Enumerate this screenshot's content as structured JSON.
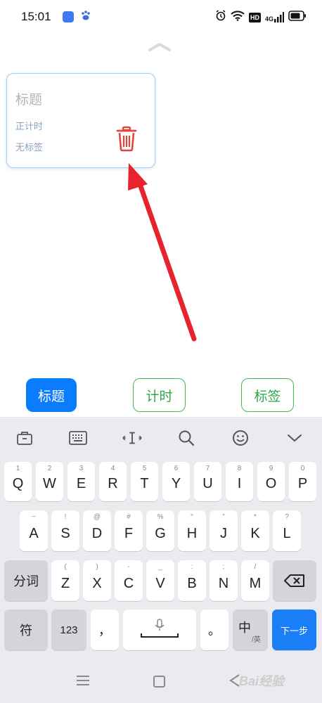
{
  "status_bar": {
    "time": "15:01",
    "hd_badge": "HD",
    "network": "4G"
  },
  "card": {
    "title_placeholder": "标题",
    "timer_label": "正计时",
    "tag_label": "无标签",
    "delete_icon": "trash-icon"
  },
  "annotation": {
    "arrow_color": "#e8232d"
  },
  "mode_buttons": [
    {
      "label": "标题",
      "selected": true
    },
    {
      "label": "计时",
      "selected": false
    },
    {
      "label": "标签",
      "selected": false
    }
  ],
  "keyboard": {
    "toolbar": [
      "toolbox-icon",
      "keyboard-icon",
      "cursor-icon",
      "search-icon",
      "emoji-icon",
      "collapse-icon"
    ],
    "row1": [
      {
        "key": "Q",
        "hint": "1"
      },
      {
        "key": "W",
        "hint": "2"
      },
      {
        "key": "E",
        "hint": "3"
      },
      {
        "key": "R",
        "hint": "4"
      },
      {
        "key": "T",
        "hint": "5"
      },
      {
        "key": "Y",
        "hint": "6"
      },
      {
        "key": "U",
        "hint": "7"
      },
      {
        "key": "I",
        "hint": "8"
      },
      {
        "key": "O",
        "hint": "9"
      },
      {
        "key": "P",
        "hint": "0"
      }
    ],
    "row2": [
      {
        "key": "A",
        "hint": "~"
      },
      {
        "key": "S",
        "hint": "!"
      },
      {
        "key": "D",
        "hint": "@"
      },
      {
        "key": "F",
        "hint": "#"
      },
      {
        "key": "G",
        "hint": "%"
      },
      {
        "key": "H",
        "hint": "“"
      },
      {
        "key": "J",
        "hint": "”"
      },
      {
        "key": "K",
        "hint": "*"
      },
      {
        "key": "L",
        "hint": "?"
      }
    ],
    "row3": [
      {
        "key": "Z",
        "hint": "("
      },
      {
        "key": "X",
        "hint": ")"
      },
      {
        "key": "C",
        "hint": "-"
      },
      {
        "key": "V",
        "hint": "_"
      },
      {
        "key": "B",
        "hint": ":"
      },
      {
        "key": "N",
        "hint": ";"
      },
      {
        "key": "M",
        "hint": "/"
      }
    ],
    "fenci": "分词",
    "symbols": "符",
    "numbers": "123",
    "comma": "，",
    "period": "。",
    "lang_main": "中",
    "lang_sub": "/英",
    "next": "下一步"
  },
  "nav_bar": {
    "watermark": "Bai经验"
  }
}
